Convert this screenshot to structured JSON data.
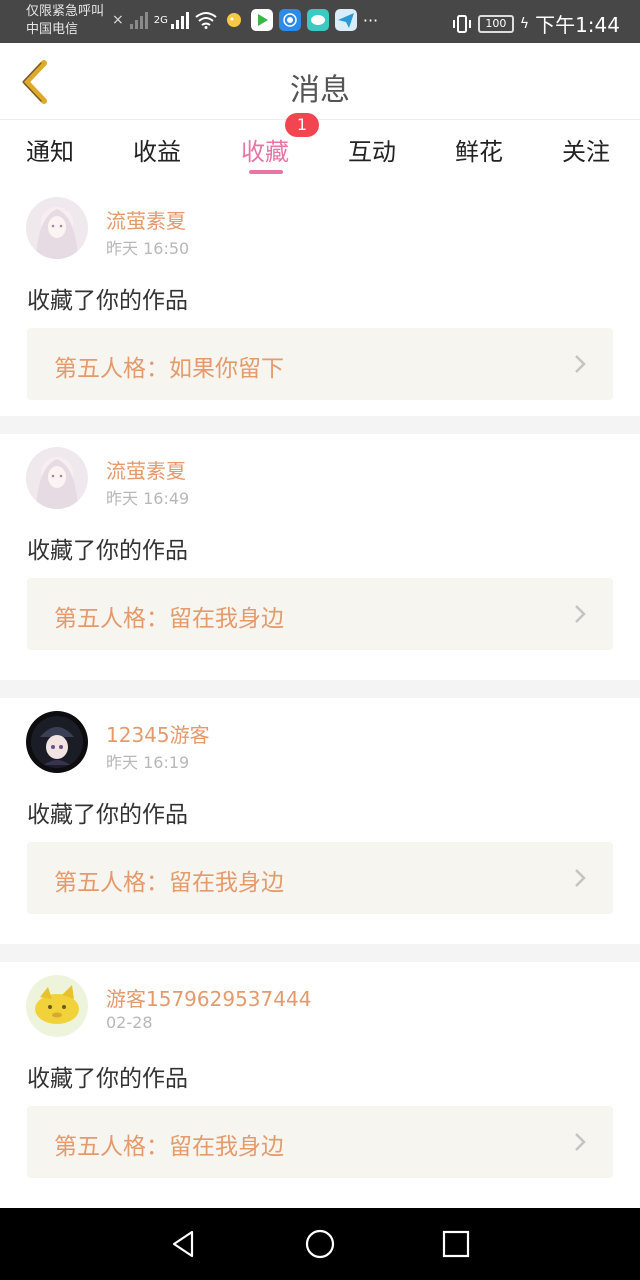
{
  "status": {
    "carrier_line1": "仅限紧急呼叫",
    "carrier_line2": "中国电信",
    "x_mark": "×",
    "network": "2G",
    "more": "···",
    "battery": "100",
    "time": "下午1:44"
  },
  "header": {
    "title": "消息"
  },
  "tabs": [
    {
      "label": "通知"
    },
    {
      "label": "收益"
    },
    {
      "label": "收藏",
      "badge": "1"
    },
    {
      "label": "互动"
    },
    {
      "label": "鲜花"
    },
    {
      "label": "关注"
    }
  ],
  "messages": [
    {
      "user": "流萤素夏",
      "time": "昨天 16:50",
      "action": "收藏了你的作品",
      "work": "第五人格：如果你留下"
    },
    {
      "user": "流萤素夏",
      "time": "昨天 16:49",
      "action": "收藏了你的作品",
      "work": "第五人格：留在我身边"
    },
    {
      "user": "12345游客",
      "time": "昨天 16:19",
      "action": "收藏了你的作品",
      "work": "第五人格：留在我身边"
    },
    {
      "user": "游客1579629537444",
      "time": "02-28",
      "action": "收藏了你的作品",
      "work": "第五人格：留在我身边"
    }
  ],
  "colors": {
    "accent": "#e776a6",
    "name": "#e59a6c",
    "badge": "#f2454f",
    "back": "#e0a92c"
  }
}
